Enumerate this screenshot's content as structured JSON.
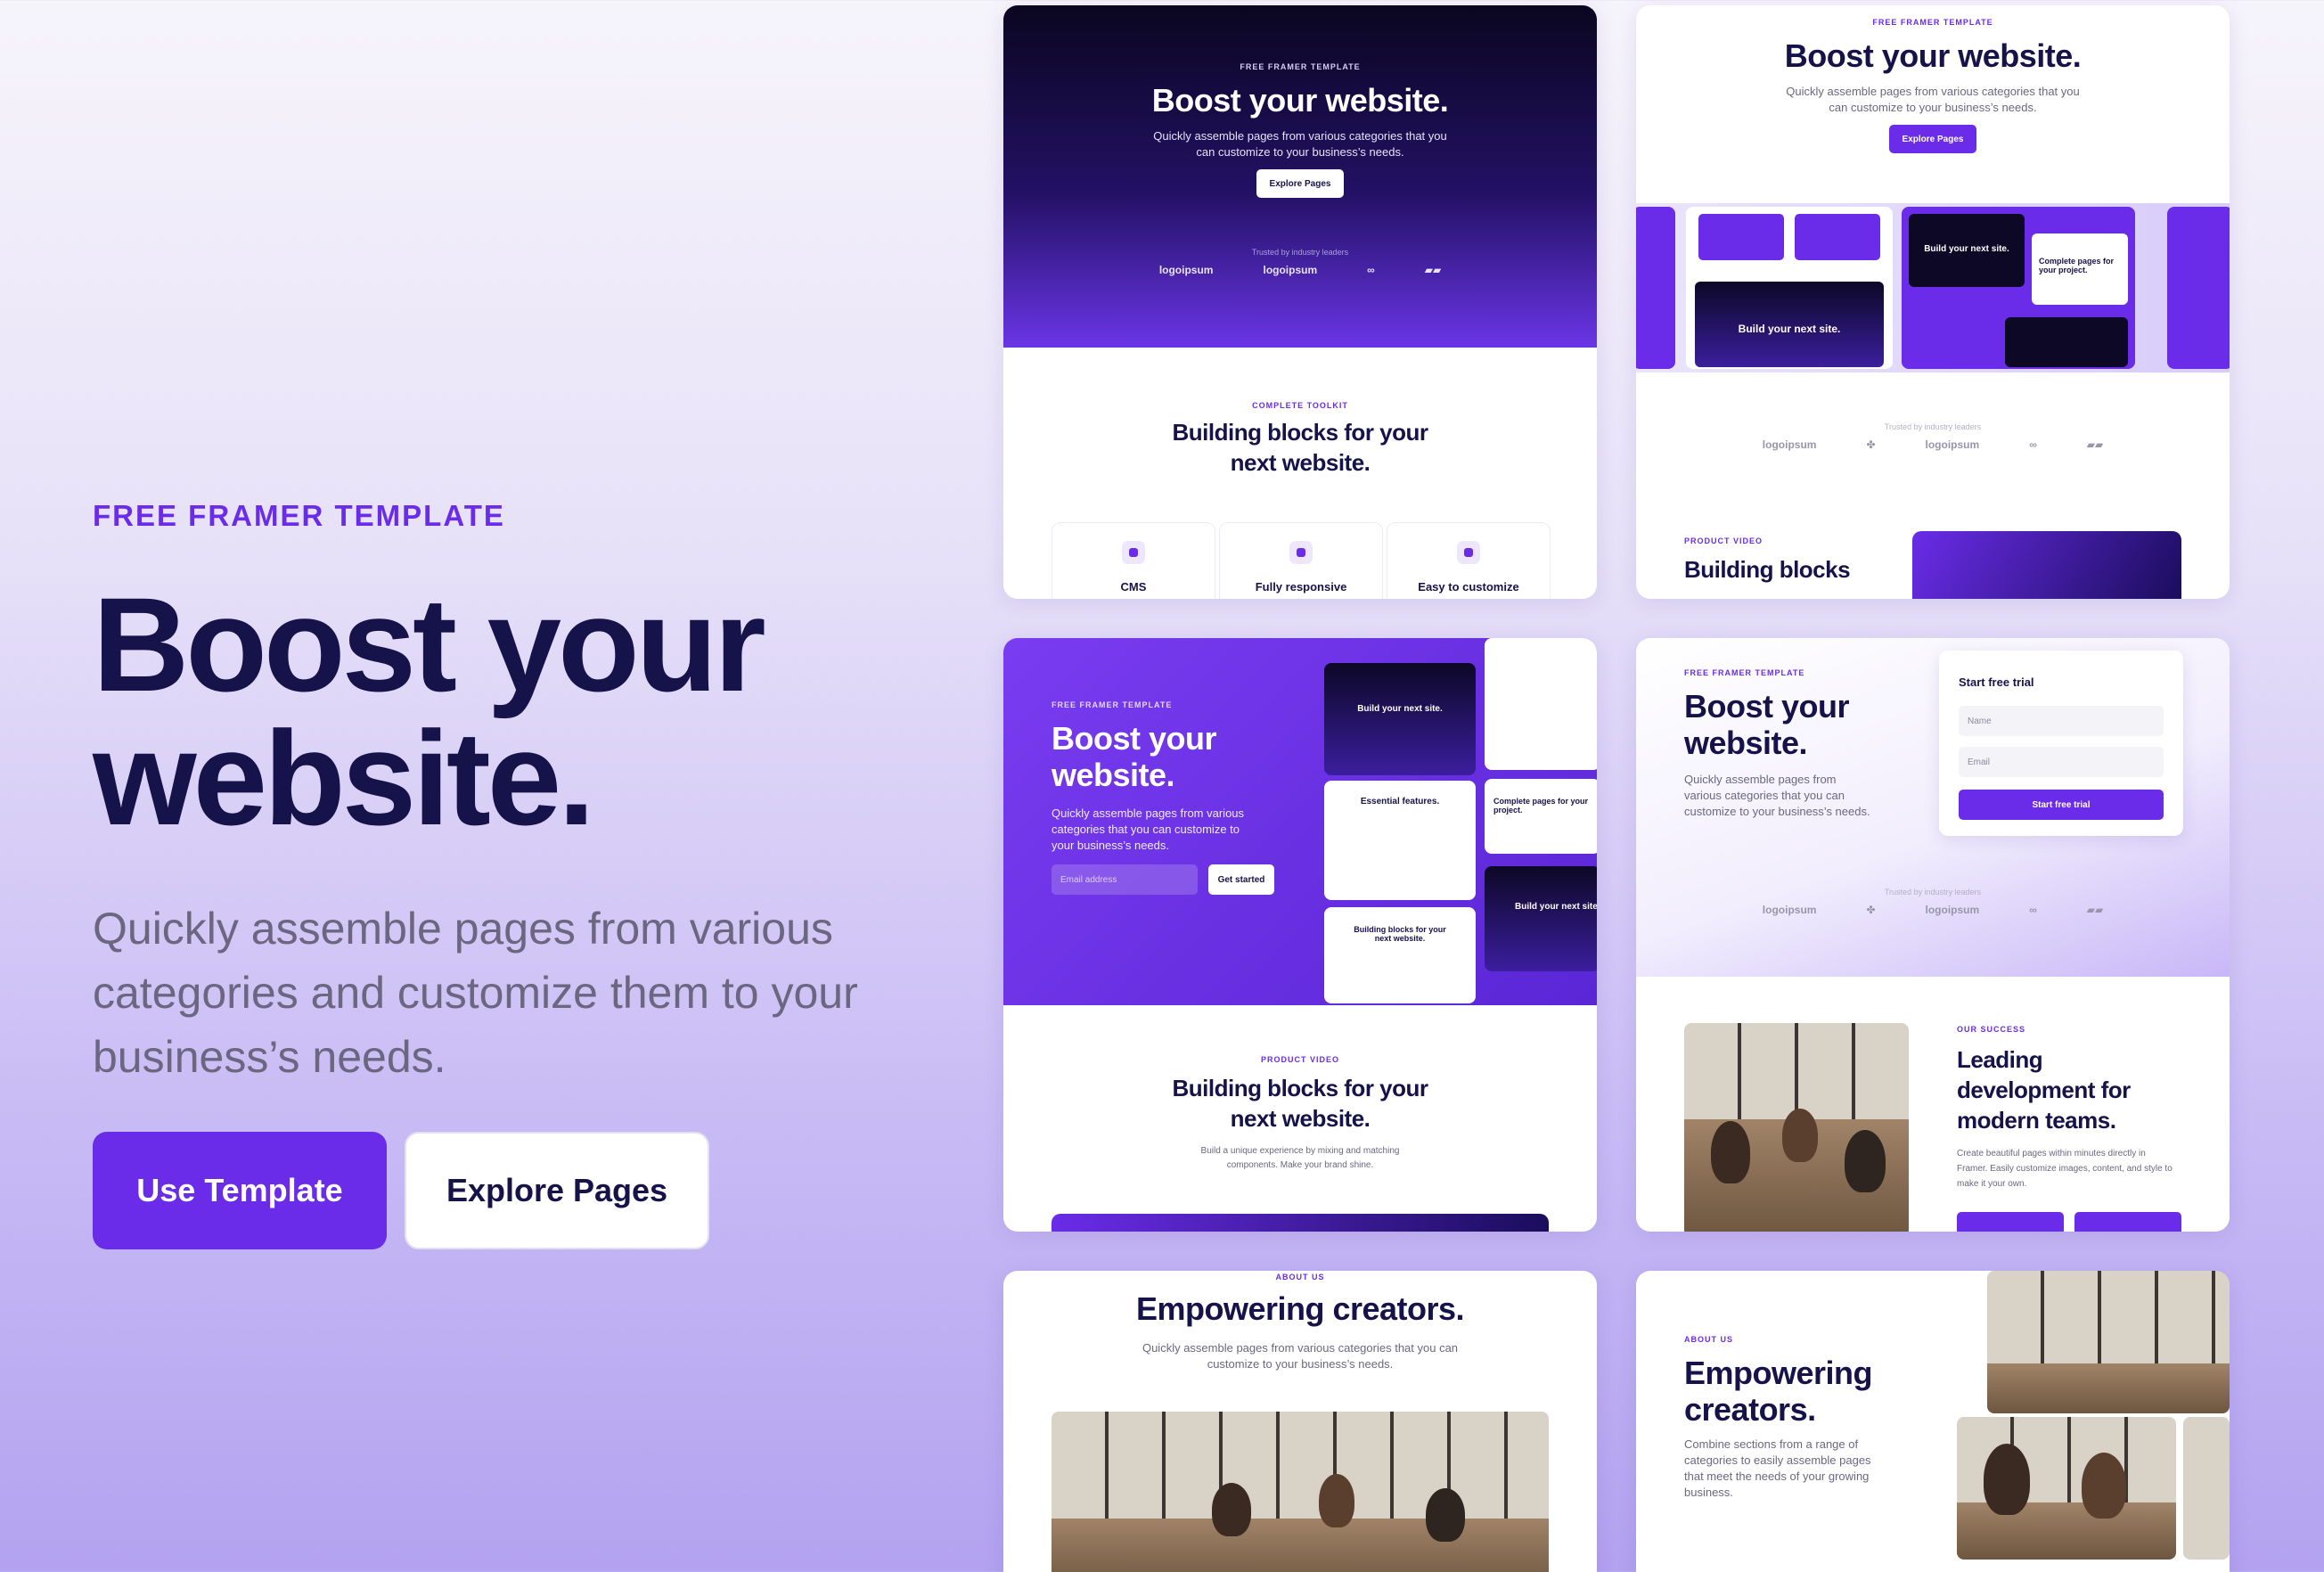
{
  "hero": {
    "eyebrow": "FREE FRAMER TEMPLATE",
    "title_line1": "Boost your",
    "title_line2": "website.",
    "subtitle_line1": "Quickly assemble pages from various",
    "subtitle_line2": "categories and customize them to your",
    "subtitle_line3": "business’s needs.",
    "primary_button": "Use Template",
    "secondary_button": "Explore Pages"
  },
  "card1": {
    "eyebrow": "FREE FRAMER TEMPLATE",
    "title": "Boost your website.",
    "sub_line1": "Quickly assemble pages from various categories that you",
    "sub_line2": "can customize to your business’s needs.",
    "button": "Explore Pages",
    "trusted": "Trusted by industry leaders",
    "logos": [
      "logoipsum",
      "logoipsum"
    ],
    "section_eyebrow": "COMPLETE TOOLKIT",
    "section_title_line1": "Building blocks for your",
    "section_title_line2": "next website.",
    "features": [
      "CMS",
      "Fully responsive",
      "Easy to customize"
    ]
  },
  "card2": {
    "eyebrow": "FREE FRAMER TEMPLATE",
    "title": "Boost your website.",
    "sub_line1": "Quickly assemble pages from various categories that you",
    "sub_line2": "can customize to your business’s needs.",
    "button": "Explore Pages",
    "shot_title1": "Build your next site.",
    "shot_title2": "Build your next site.",
    "shot_title3": "Complete pages for your project.",
    "trusted": "Trusted by industry leaders",
    "logos": [
      "logoipsum",
      "logoipsum"
    ],
    "section_eyebrow": "PRODUCT VIDEO",
    "section_title": "Building blocks"
  },
  "card3": {
    "eyebrow": "FREE FRAMER TEMPLATE",
    "title_line1": "Boost your",
    "title_line2": "website.",
    "sub_line1": "Quickly assemble pages from various",
    "sub_line2": "categories that you can customize to",
    "sub_line3": "your business’s needs.",
    "email_placeholder": "Email address",
    "button": "Get started",
    "shot_title1": "Build your next site.",
    "shot_title2": "Essential features.",
    "shot_title3": "Building blocks for your next website.",
    "shot_title4": "Complete pages for your project.",
    "shot_title5": "Build your next site",
    "section_eyebrow": "PRODUCT VIDEO",
    "section_title_line1": "Building blocks for your",
    "section_title_line2": "next website.",
    "section_sub_line1": "Build a unique experience by mixing and matching",
    "section_sub_line2": "components. Make your brand shine."
  },
  "card4": {
    "eyebrow": "FREE FRAMER TEMPLATE",
    "title_line1": "Boost your",
    "title_line2": "website.",
    "sub_line1": "Quickly assemble pages from",
    "sub_line2": "various categories that you can",
    "sub_line3": "customize to your business’s needs.",
    "form_title": "Start free trial",
    "name_placeholder": "Name",
    "email_placeholder": "Email",
    "form_button": "Start free trial",
    "trusted": "Trusted by industry leaders",
    "logos": [
      "logoipsum",
      "logoipsum"
    ],
    "section_eyebrow": "OUR SUCCESS",
    "section_title_line1": "Leading",
    "section_title_line2": "development for",
    "section_title_line3": "modern teams.",
    "section_sub_line1": "Create beautiful pages within minutes directly in",
    "section_sub_line2": "Framer. Easily customize images, content, and style to",
    "section_sub_line3": "make it your own."
  },
  "card5": {
    "eyebrow": "ABOUT US",
    "title": "Empowering creators.",
    "sub_line1": "Quickly assemble pages from various categories that you can",
    "sub_line2": "customize to your business’s needs."
  },
  "card6": {
    "eyebrow": "ABOUT US",
    "title_line1": "Empowering",
    "title_line2": "creators.",
    "sub_line1": "Combine sections from a range of",
    "sub_line2": "categories to easily assemble pages",
    "sub_line3": "that meet the needs of your growing",
    "sub_line4": "business."
  },
  "colors": {
    "accent": "#6a2ce8",
    "dark": "#16124a",
    "muted": "#6b6780"
  }
}
